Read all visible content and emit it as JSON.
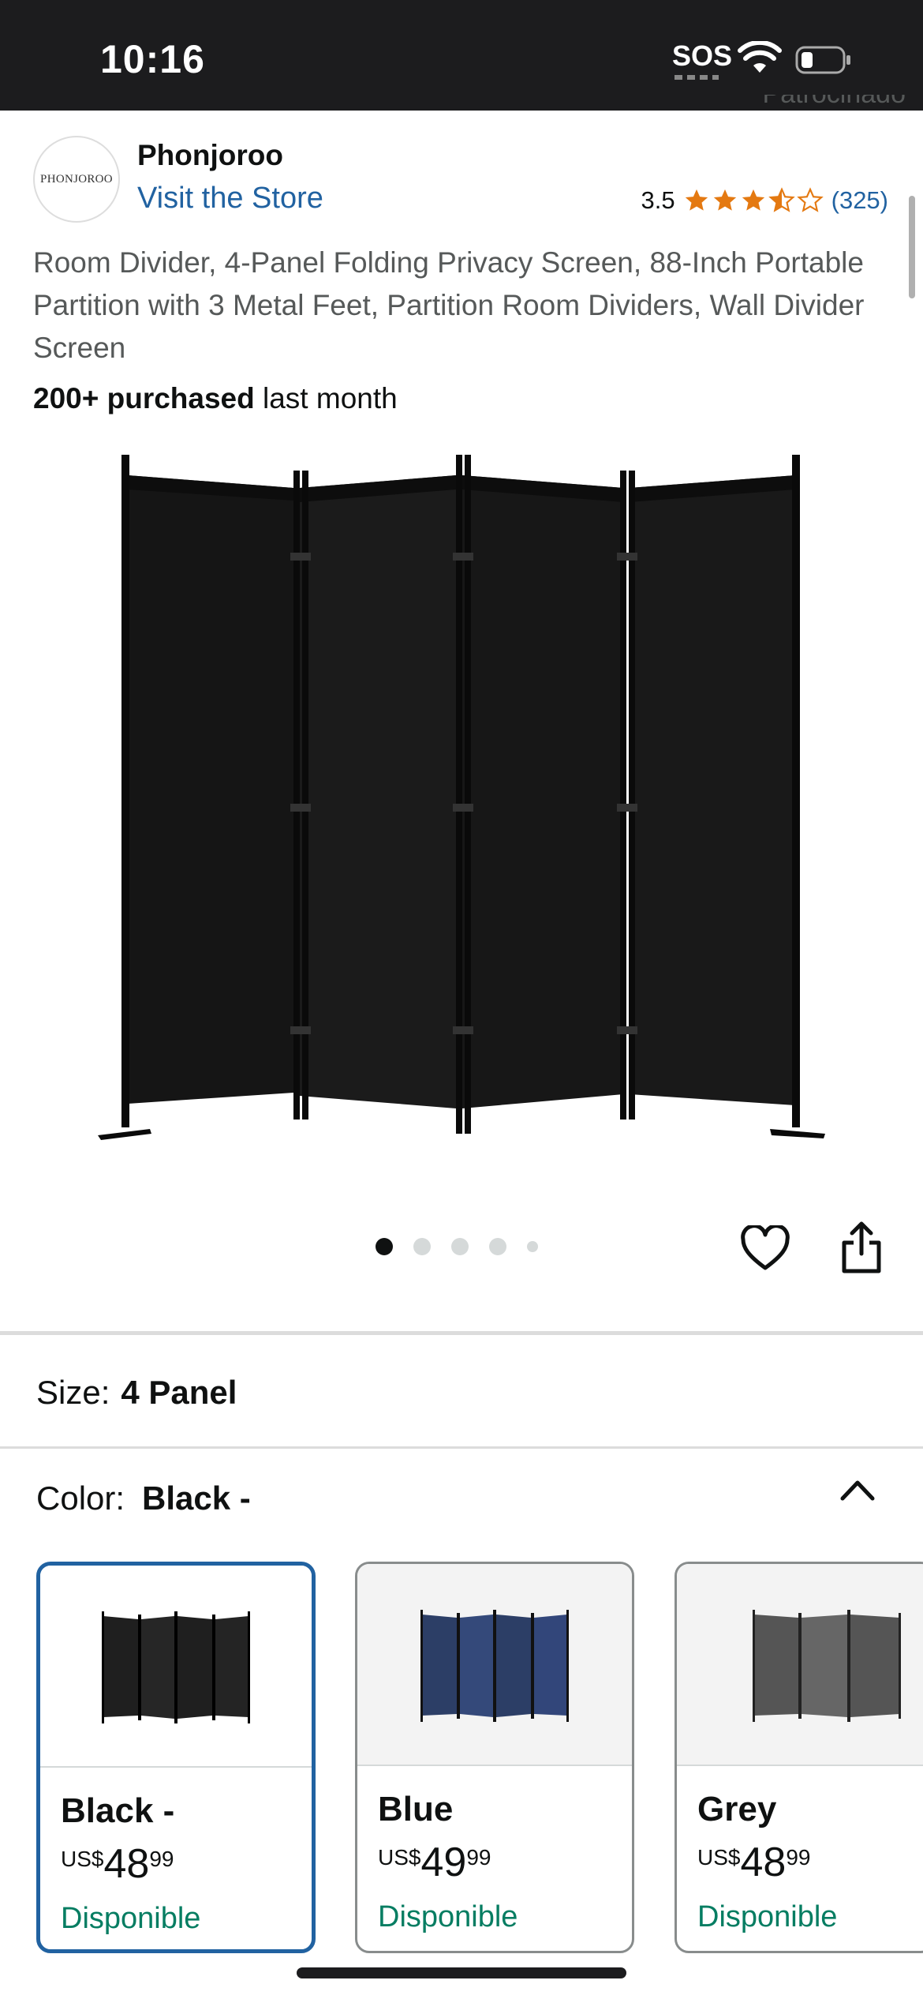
{
  "status_bar": {
    "time": "10:16",
    "sos": "SOS"
  },
  "sponsored_label": "Patrocinado",
  "brand": {
    "logo_text": "PHONJOROO",
    "name": "Phonjoroo",
    "visit_store": "Visit the Store"
  },
  "rating": {
    "value": "3.5",
    "stars": 3.5,
    "count": "(325)",
    "star_color": "#e47911"
  },
  "product": {
    "title": "Room Divider, 4-Panel Folding Privacy Screen, 88-Inch Portable Partition with 3 Metal Feet, Partition Room Dividers, Wall Divider Screen",
    "purchased_bold": "200+ purchased",
    "purchased_rest": " last month"
  },
  "carousel": {
    "dots": 5,
    "active_index": 0
  },
  "size": {
    "label": "Size:",
    "value": "4 Panel"
  },
  "color": {
    "label": "Color:",
    "value": "Black -"
  },
  "swatches": [
    {
      "name": "Black -",
      "currency": "US$",
      "whole": "48",
      "fraction": "99",
      "availability": "Disponible",
      "panel_color": "#1f1f1f",
      "selected": true
    },
    {
      "name": "Blue",
      "currency": "US$",
      "whole": "49",
      "fraction": "99",
      "availability": "Disponible",
      "panel_color": "#2c3e66",
      "selected": false
    },
    {
      "name": "Grey",
      "currency": "US$",
      "whole": "48",
      "fraction": "99",
      "availability": "Disponible",
      "panel_color": "#555555",
      "selected": false
    }
  ],
  "colors": {
    "link": "#2162a1",
    "available": "#067d62",
    "selected_border": "#2162a1"
  }
}
